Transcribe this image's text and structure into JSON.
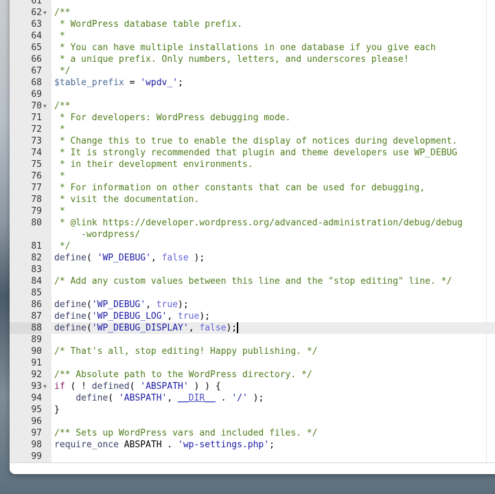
{
  "editor": {
    "active_line": "88",
    "lines": [
      {
        "n": "61",
        "t": []
      },
      {
        "n": "62",
        "fold": true,
        "t": [
          {
            "c": "comment",
            "v": "/**"
          }
        ]
      },
      {
        "n": "63",
        "t": [
          {
            "c": "comment",
            "v": " * WordPress database table prefix."
          }
        ]
      },
      {
        "n": "64",
        "t": [
          {
            "c": "comment",
            "v": " *"
          }
        ]
      },
      {
        "n": "65",
        "t": [
          {
            "c": "comment",
            "v": " * You can have multiple installations in one database if you give each"
          }
        ]
      },
      {
        "n": "66",
        "t": [
          {
            "c": "comment",
            "v": " * a unique prefix. Only numbers, letters, and underscores please!"
          }
        ]
      },
      {
        "n": "67",
        "t": [
          {
            "c": "comment",
            "v": " */"
          }
        ]
      },
      {
        "n": "68",
        "t": [
          {
            "c": "var",
            "v": "$table_prefix"
          },
          {
            "c": "plain",
            "v": " = "
          },
          {
            "c": "string",
            "v": "'wpdv_'"
          },
          {
            "c": "plain",
            "v": ";"
          }
        ]
      },
      {
        "n": "69",
        "t": []
      },
      {
        "n": "70",
        "fold": true,
        "t": [
          {
            "c": "comment",
            "v": "/**"
          }
        ]
      },
      {
        "n": "71",
        "t": [
          {
            "c": "comment",
            "v": " * For developers: WordPress debugging mode."
          }
        ]
      },
      {
        "n": "72",
        "t": [
          {
            "c": "comment",
            "v": " *"
          }
        ]
      },
      {
        "n": "73",
        "t": [
          {
            "c": "comment",
            "v": " * Change this to true to enable the display of notices during development."
          }
        ]
      },
      {
        "n": "74",
        "t": [
          {
            "c": "comment",
            "v": " * It is strongly recommended that plugin and theme developers use WP_DEBUG"
          }
        ]
      },
      {
        "n": "75",
        "t": [
          {
            "c": "comment",
            "v": " * in their development environments."
          }
        ]
      },
      {
        "n": "76",
        "t": [
          {
            "c": "comment",
            "v": " *"
          }
        ]
      },
      {
        "n": "77",
        "t": [
          {
            "c": "comment",
            "v": " * For information on other constants that can be used for debugging,"
          }
        ]
      },
      {
        "n": "78",
        "t": [
          {
            "c": "comment",
            "v": " * visit the documentation."
          }
        ]
      },
      {
        "n": "79",
        "t": [
          {
            "c": "comment",
            "v": " *"
          }
        ]
      },
      {
        "n": "80",
        "t": [
          {
            "c": "comment",
            "v": " * @link https://developer.wordpress.org/advanced-administration/debug/debug"
          }
        ],
        "wrap": [
          {
            "c": "comment",
            "v": "-wordpress/"
          }
        ]
      },
      {
        "n": "81",
        "t": [
          {
            "c": "comment",
            "v": " */"
          }
        ]
      },
      {
        "n": "82",
        "t": [
          {
            "c": "fn",
            "v": "define"
          },
          {
            "c": "plain",
            "v": "( "
          },
          {
            "c": "string",
            "v": "'WP_DEBUG'"
          },
          {
            "c": "plain",
            "v": ", "
          },
          {
            "c": "const",
            "v": "false"
          },
          {
            "c": "plain",
            "v": " );"
          }
        ]
      },
      {
        "n": "83",
        "t": []
      },
      {
        "n": "84",
        "t": [
          {
            "c": "comment",
            "v": "/* Add any custom values between this line and the \"stop editing\" line. */"
          }
        ]
      },
      {
        "n": "85",
        "t": []
      },
      {
        "n": "86",
        "t": [
          {
            "c": "fn",
            "v": "define"
          },
          {
            "c": "plain",
            "v": "("
          },
          {
            "c": "string",
            "v": "'WP_DEBUG'"
          },
          {
            "c": "plain",
            "v": ", "
          },
          {
            "c": "const",
            "v": "true"
          },
          {
            "c": "plain",
            "v": ");"
          }
        ]
      },
      {
        "n": "87",
        "t": [
          {
            "c": "fn",
            "v": "define"
          },
          {
            "c": "plain",
            "v": "("
          },
          {
            "c": "string",
            "v": "'WP_DEBUG_LOG'"
          },
          {
            "c": "plain",
            "v": ", "
          },
          {
            "c": "const",
            "v": "true"
          },
          {
            "c": "plain",
            "v": ");"
          }
        ]
      },
      {
        "n": "88",
        "t": [
          {
            "c": "fn",
            "v": "define"
          },
          {
            "c": "plain",
            "v": "("
          },
          {
            "c": "string",
            "v": "'WP_DEBUG_DISPLAY'"
          },
          {
            "c": "plain",
            "v": ", "
          },
          {
            "c": "const",
            "v": "false"
          },
          {
            "c": "plain",
            "v": ");"
          }
        ]
      },
      {
        "n": "89",
        "t": []
      },
      {
        "n": "90",
        "t": [
          {
            "c": "comment",
            "v": "/* That's all, stop editing! Happy publishing. */"
          }
        ]
      },
      {
        "n": "91",
        "t": []
      },
      {
        "n": "92",
        "t": [
          {
            "c": "comment",
            "v": "/** Absolute path to the WordPress directory. */"
          }
        ]
      },
      {
        "n": "93",
        "fold": true,
        "t": [
          {
            "c": "kw",
            "v": "if"
          },
          {
            "c": "plain",
            "v": " ( ! "
          },
          {
            "c": "fn",
            "v": "defined"
          },
          {
            "c": "plain",
            "v": "( "
          },
          {
            "c": "string",
            "v": "'ABSPATH'"
          },
          {
            "c": "plain",
            "v": " ) ) {"
          }
        ]
      },
      {
        "n": "94",
        "t": [
          {
            "c": "plain",
            "v": "    "
          },
          {
            "c": "fn",
            "v": "define"
          },
          {
            "c": "plain",
            "v": "( "
          },
          {
            "c": "string",
            "v": "'ABSPATH'"
          },
          {
            "c": "plain",
            "v": ", "
          },
          {
            "c": "magic",
            "v": "__DIR__"
          },
          {
            "c": "plain",
            "v": " . "
          },
          {
            "c": "string",
            "v": "'/'"
          },
          {
            "c": "plain",
            "v": " );"
          }
        ]
      },
      {
        "n": "95",
        "t": [
          {
            "c": "plain",
            "v": "}"
          }
        ]
      },
      {
        "n": "96",
        "t": []
      },
      {
        "n": "97",
        "t": [
          {
            "c": "comment",
            "v": "/** Sets up WordPress vars and included files. */"
          }
        ]
      },
      {
        "n": "98",
        "t": [
          {
            "c": "fn",
            "v": "require_once"
          },
          {
            "c": "plain",
            "v": " ABSPATH . "
          },
          {
            "c": "string",
            "v": "'wp-settings.php'"
          },
          {
            "c": "plain",
            "v": ";"
          }
        ]
      },
      {
        "n": "99",
        "t": []
      }
    ]
  }
}
